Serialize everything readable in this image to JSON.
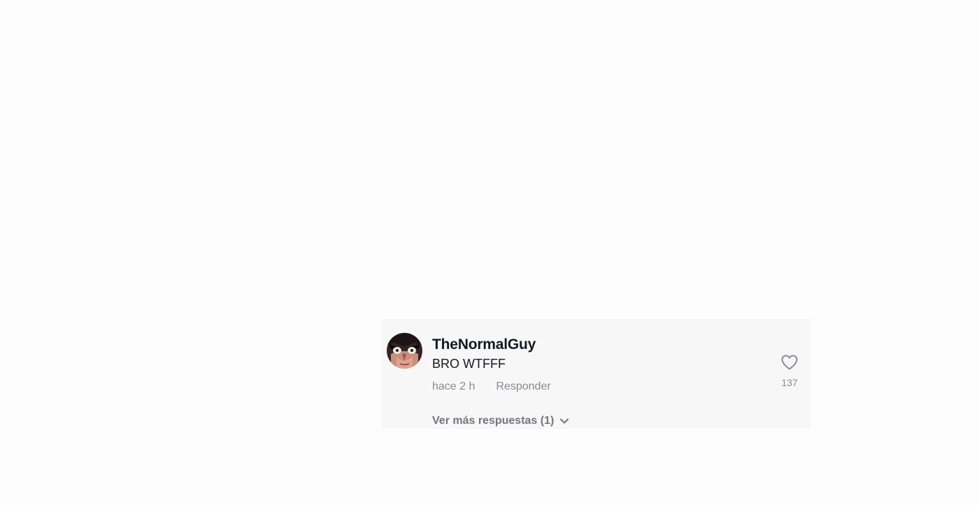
{
  "comment": {
    "username": "TheNormalGuy",
    "text": "BRO WTFFF",
    "time": "hace 2 h",
    "reply_label": "Responder",
    "likes": "137",
    "more_replies_label": "Ver más respuestas (1)",
    "avatar_icon": "cartoon-face-avatar",
    "like_icon": "heart-outline-icon",
    "chevron_icon": "chevron-down-icon"
  },
  "colors": {
    "card_background": "#f7f7f7",
    "page_background": "#fdfdfd",
    "primary_text": "#161823",
    "secondary_text": "#8a8b91"
  }
}
